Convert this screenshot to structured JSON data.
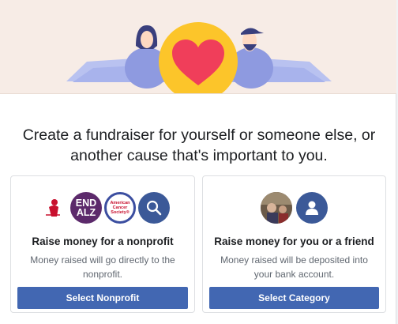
{
  "hero": {
    "bg_color": "#f7ece6",
    "heart_color": "#f03e5a",
    "circle_color": "#fcc52a",
    "figure_color": "#a8b3ec"
  },
  "headline": {
    "line1": "Create a fundraiser for yourself or someone else, or",
    "line2": "another cause that's important to you."
  },
  "cards": {
    "nonprofit": {
      "title": "Raise money for a nonprofit",
      "desc_line1": "Money raised will go directly to the",
      "desc_line2": "nonprofit.",
      "button_label": "Select Nonprofit",
      "logos": {
        "end_alz_line1": "END",
        "end_alz_line2": "ALZ",
        "acs_line1": "American",
        "acs_line2": "Cancer",
        "acs_line3": "Society®"
      },
      "icons": [
        "st-jude-logo",
        "end-alz-logo",
        "american-cancer-society-logo",
        "search-icon"
      ]
    },
    "personal": {
      "title": "Raise money for you or a friend",
      "desc_line1": "Money raised will be deposited into",
      "desc_line2": "your bank account.",
      "button_label": "Select Category",
      "icons": [
        "profile-photo",
        "person-icon"
      ]
    }
  },
  "colors": {
    "button": "#4267b2",
    "icon_circle": "#3b5998"
  }
}
